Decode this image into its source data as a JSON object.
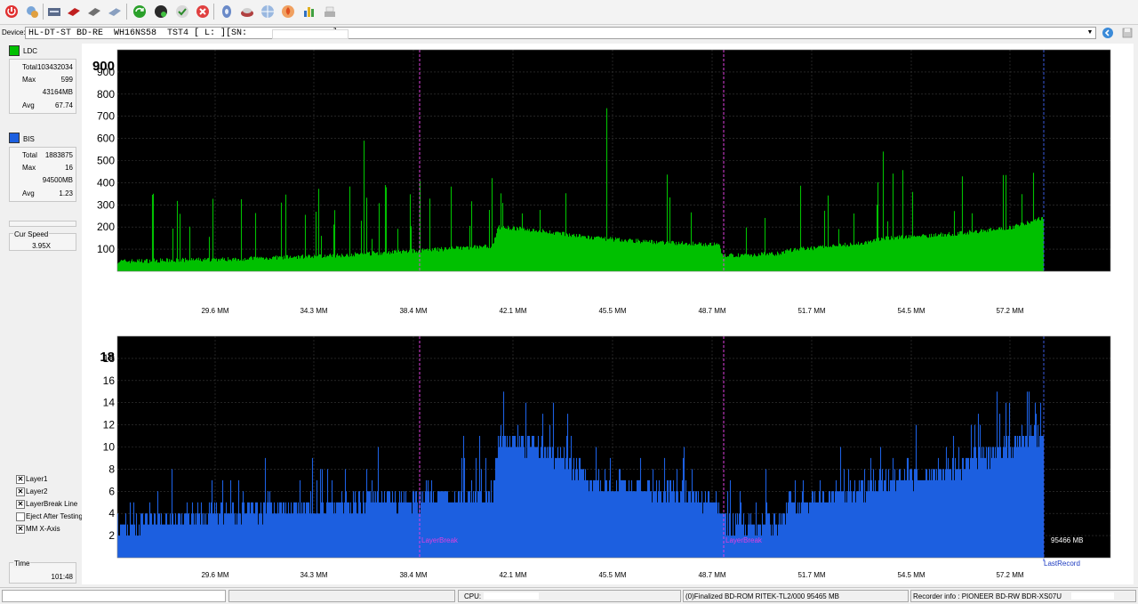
{
  "toolbar": {
    "icons": [
      "power-icon",
      "settings-icon",
      "drive-icon",
      "disc-red-icon",
      "disc-gray-icon",
      "copy-icon",
      "refresh-icon",
      "globe-icon",
      "check-icon",
      "stop-icon",
      "disc-blue-icon",
      "eject-icon",
      "network-icon",
      "flame-icon",
      "chart-icon",
      "scanner-icon"
    ]
  },
  "device": {
    "label": "Device:",
    "text": "HL-DT-ST BD-RE  WH16NS58  TST4 [ L: ][SN:                ]"
  },
  "sidebar": {
    "ldc": {
      "title": "LDC",
      "color": "#00c000",
      "rows": [
        {
          "k": "Total",
          "v": "103432034"
        },
        {
          "k": "Max",
          "v": "599"
        },
        {
          "k": "",
          "v": "43164MB"
        },
        {
          "k": "Avg",
          "v": "67.74"
        }
      ]
    },
    "bis": {
      "title": "BIS",
      "color": "#1c5fe0",
      "rows": [
        {
          "k": "Total",
          "v": "1883875"
        },
        {
          "k": "Max",
          "v": "16"
        },
        {
          "k": "",
          "v": "94500MB"
        },
        {
          "k": "Avg",
          "v": "1.23"
        }
      ]
    },
    "cur_speed": {
      "label": "Cur Speed",
      "value": "3.95X"
    },
    "checks": [
      {
        "label": "Layer1",
        "checked": true
      },
      {
        "label": "Layer2",
        "checked": true
      },
      {
        "label": "LayerBreak Line",
        "checked": true
      },
      {
        "label": "Eject After Testing",
        "checked": false
      },
      {
        "label": "MM X-Axis",
        "checked": true
      }
    ],
    "time": {
      "label": "Time",
      "value": "101:48"
    }
  },
  "status": {
    "cpu_label": "CPU:",
    "disc_info": "(0)Finalized  BD-ROM  RITEK-TL2/000  95465 MB",
    "recorder_info": "Recorder info : PIONEER      BD-RW  BDR-XS07U"
  },
  "chart_data": [
    {
      "type": "area",
      "series": [
        {
          "name": "LDC",
          "color": "#00c000"
        }
      ],
      "x_ticks": [
        "29.6 MM",
        "34.3 MM",
        "38.4 MM",
        "42.1 MM",
        "45.5 MM",
        "48.7 MM",
        "51.7 MM",
        "54.5 MM",
        "57.2 MM"
      ],
      "y_ticks": [
        100,
        200,
        300,
        400,
        500,
        600,
        700,
        800,
        900
      ],
      "ylim": [
        0,
        1000
      ],
      "y_top_label": "900",
      "layer_breaks_mb": [
        38.5,
        48.7
      ],
      "last_record_mm": 58.0,
      "x_range_mm": [
        25.0,
        60.5
      ],
      "baseline_profile": [
        {
          "x": 25.0,
          "y": 45
        },
        {
          "x": 29.0,
          "y": 55
        },
        {
          "x": 32.5,
          "y": 70
        },
        {
          "x": 36.0,
          "y": 95
        },
        {
          "x": 38.4,
          "y": 115
        },
        {
          "x": 38.6,
          "y": 200
        },
        {
          "x": 40.0,
          "y": 185
        },
        {
          "x": 42.0,
          "y": 150
        },
        {
          "x": 44.5,
          "y": 130
        },
        {
          "x": 46.5,
          "y": 120
        },
        {
          "x": 46.6,
          "y": 70
        },
        {
          "x": 48.7,
          "y": 80
        },
        {
          "x": 49.0,
          "y": 95
        },
        {
          "x": 51.5,
          "y": 125
        },
        {
          "x": 52.5,
          "y": 150
        },
        {
          "x": 55.0,
          "y": 170
        },
        {
          "x": 57.0,
          "y": 200
        },
        {
          "x": 58.0,
          "y": 240
        }
      ],
      "grid": true
    },
    {
      "type": "area",
      "series": [
        {
          "name": "BIS",
          "color": "#1c5fe0"
        }
      ],
      "x_ticks": [
        "29.6 MM",
        "34.3 MM",
        "38.4 MM",
        "42.1 MM",
        "45.5 MM",
        "48.7 MM",
        "51.7 MM",
        "54.5 MM",
        "57.2 MM"
      ],
      "y_ticks": [
        2,
        4,
        6,
        8,
        10,
        12,
        14,
        16,
        18
      ],
      "ylim": [
        0,
        20
      ],
      "y_top_label": "18",
      "layer_break_label": "LayerBreak",
      "last_record_label": "LastRecord",
      "end_label": "95466 MB",
      "baseline_profile": [
        {
          "x": 25.0,
          "y": 3
        },
        {
          "x": 29.0,
          "y": 4
        },
        {
          "x": 33.0,
          "y": 5
        },
        {
          "x": 36.0,
          "y": 5.5
        },
        {
          "x": 38.4,
          "y": 6
        },
        {
          "x": 38.6,
          "y": 11
        },
        {
          "x": 40.0,
          "y": 10
        },
        {
          "x": 42.0,
          "y": 7
        },
        {
          "x": 44.5,
          "y": 6
        },
        {
          "x": 46.5,
          "y": 5
        },
        {
          "x": 46.6,
          "y": 3
        },
        {
          "x": 48.7,
          "y": 3
        },
        {
          "x": 49.0,
          "y": 5
        },
        {
          "x": 51.5,
          "y": 6
        },
        {
          "x": 52.5,
          "y": 7
        },
        {
          "x": 55.0,
          "y": 8
        },
        {
          "x": 57.0,
          "y": 10
        },
        {
          "x": 58.0,
          "y": 11
        }
      ],
      "grid": true
    }
  ]
}
